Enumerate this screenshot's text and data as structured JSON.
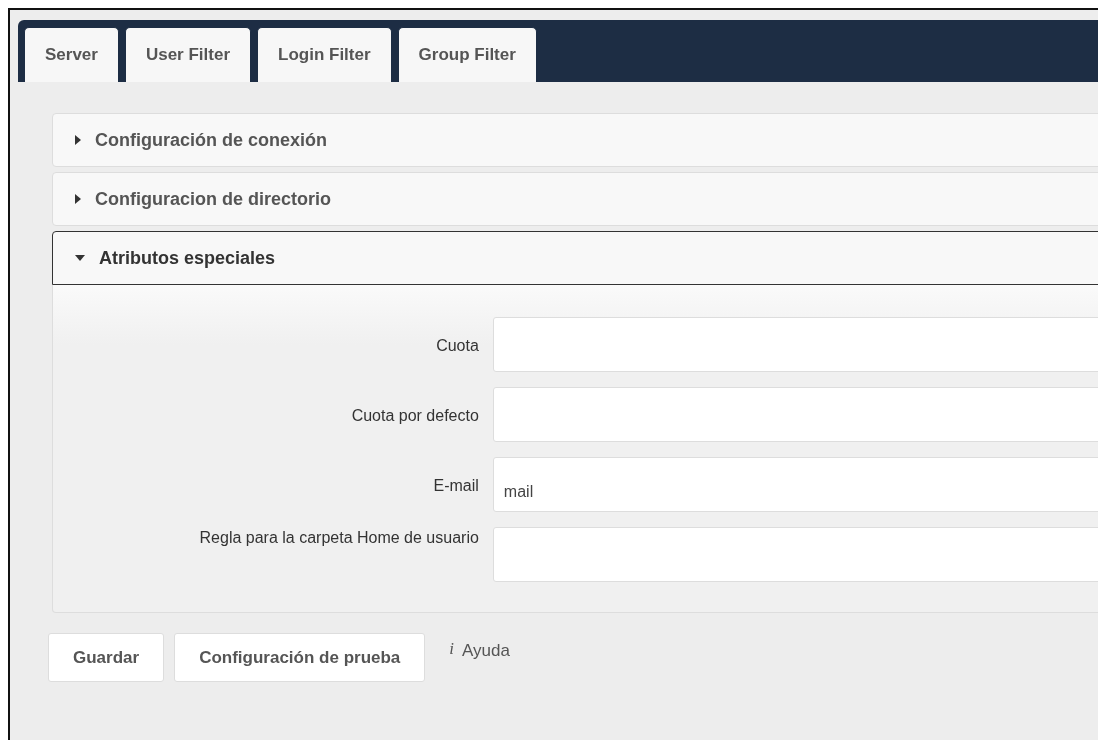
{
  "tabs": [
    {
      "label": "Server",
      "selected": false
    },
    {
      "label": "User Filter",
      "selected": false
    },
    {
      "label": "Login Filter",
      "selected": false
    },
    {
      "label": "Group Filter",
      "selected": false
    }
  ],
  "sections": [
    {
      "title": "Configuración de conexión",
      "expanded": false
    },
    {
      "title": "Configuracion de directorio",
      "expanded": false
    },
    {
      "title": "Atributos especiales",
      "expanded": true,
      "fields": [
        {
          "label": "Cuota"
        },
        {
          "label": "Cuota por defecto"
        },
        {
          "label": "E-mail",
          "value": "mail"
        },
        {
          "label": "Regla para la carpeta Home de usuario"
        }
      ]
    }
  ],
  "buttons": [
    "Guardar",
    "Configuración de prueba"
  ],
  "help": {
    "icon": "i",
    "label": "Ayuda"
  }
}
